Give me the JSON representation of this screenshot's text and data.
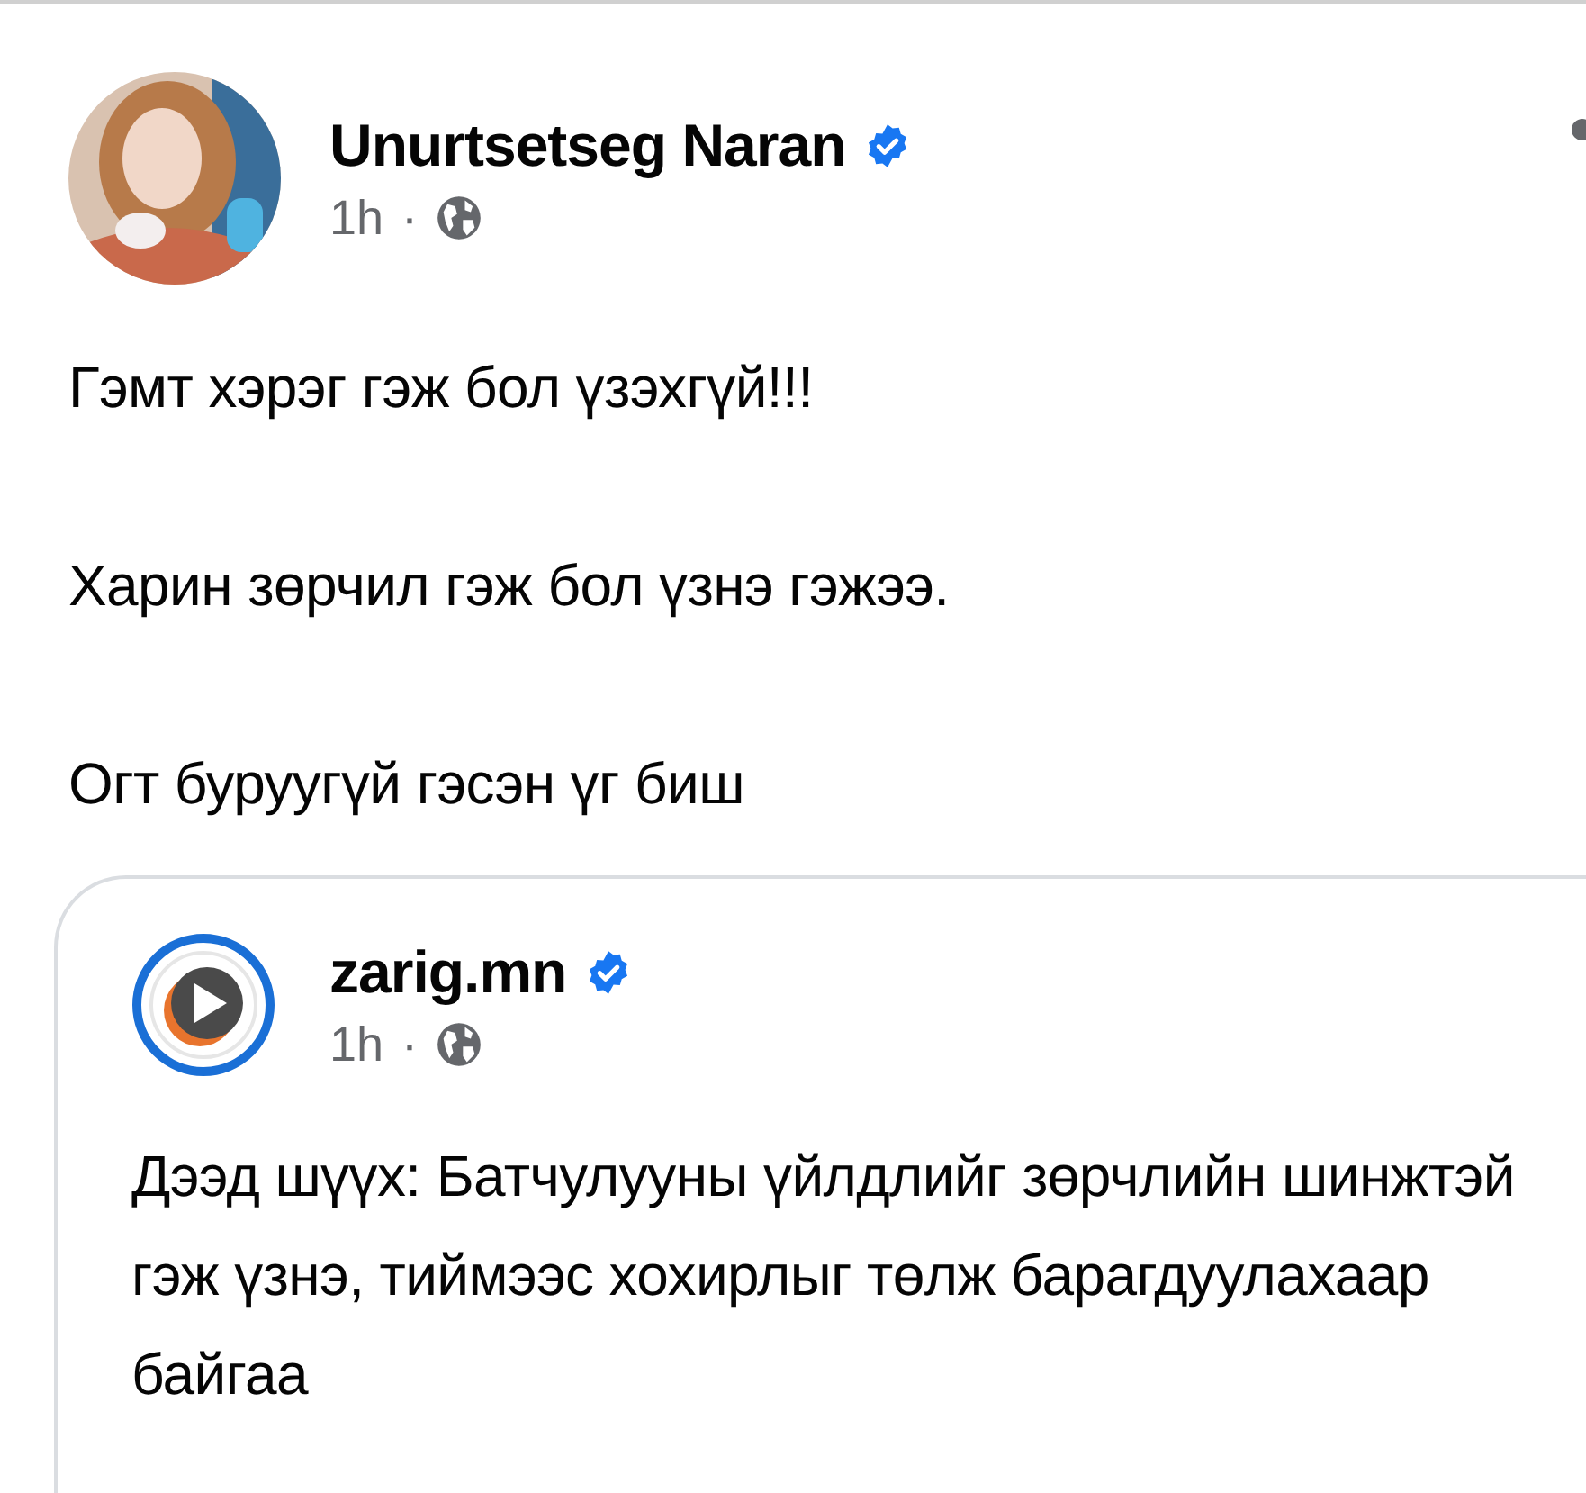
{
  "post": {
    "author": "Unurtsetseg Naran",
    "verified": true,
    "time": "1h",
    "separator": "·",
    "paragraphs": [
      "Гэмт хэрэг гэж бол үзэхгүй!!!",
      "Харин зөрчил гэж бол үзнэ гэжээ.",
      "Огт буруугүй гэсэн үг биш"
    ],
    "shared": {
      "author": "zarig.mn",
      "verified": true,
      "time": "1h",
      "separator": "·",
      "text": "Дээд шүүх: Батчулууны үйлдлийг зөрчлийн шинжтэй гэж үзнэ, тиймээс хохирлыг төлж барагдуулахаар байгаа"
    }
  }
}
